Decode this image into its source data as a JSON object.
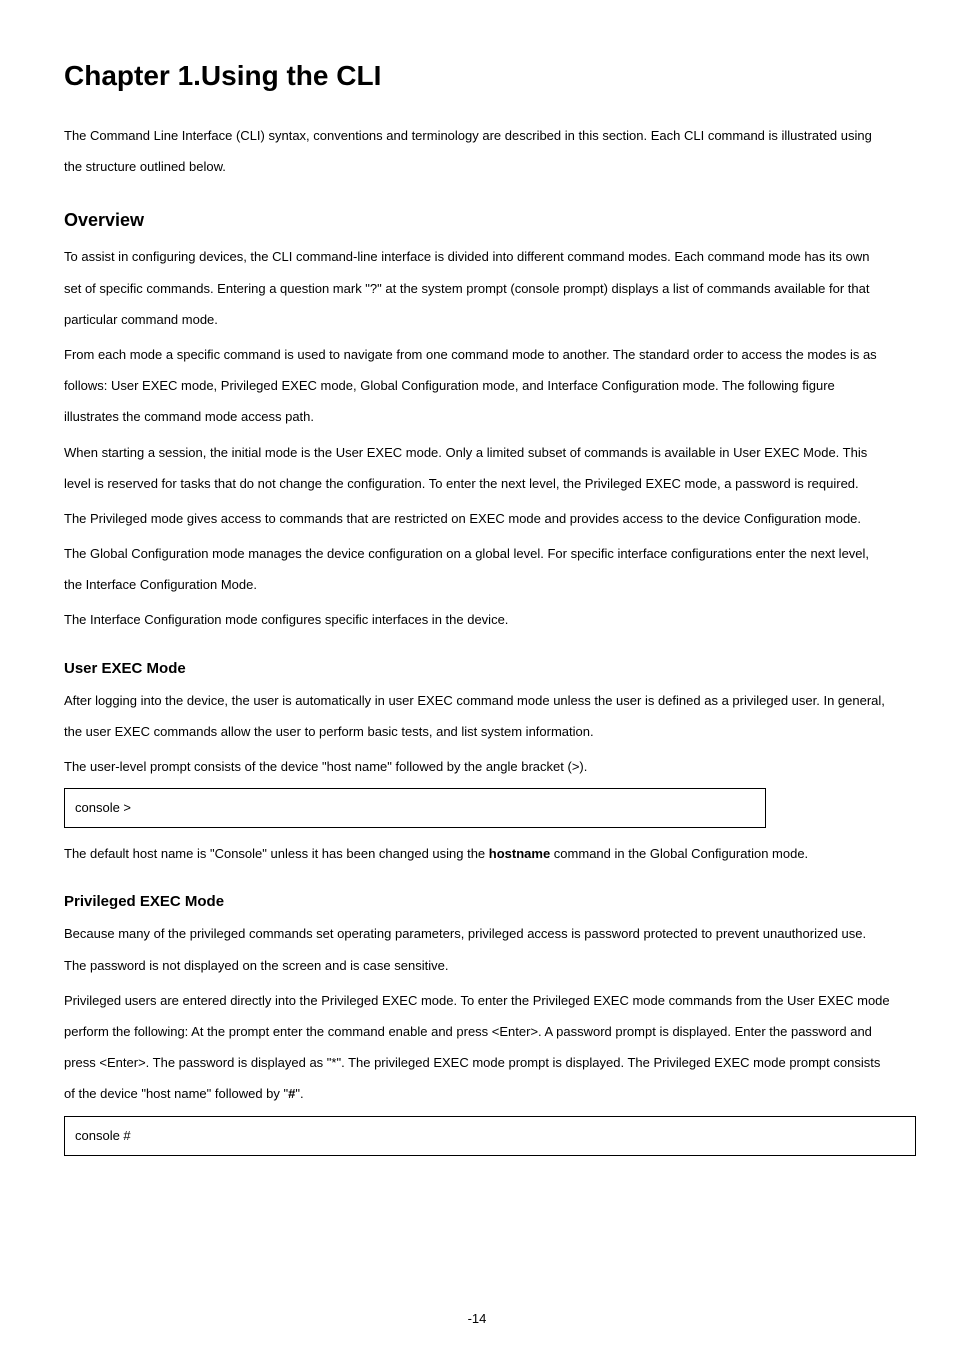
{
  "chapter": {
    "title": "Chapter 1.Using the CLI"
  },
  "intro": {
    "p1": "The Command Line Interface (CLI) syntax, conventions and terminology are described in this section. Each CLI command is illustrated using the structure outlined below."
  },
  "overview": {
    "heading": "Overview",
    "p1": "To assist in configuring devices, the CLI command-line interface is divided into different command modes. Each command mode has its own set of specific commands. Entering a question mark \"?\" at the system prompt (console prompt) displays a list of commands available for that particular command mode.",
    "p2": "From each mode a specific command is used to navigate from one command mode to another. The standard order to access the modes is as follows: User EXEC mode, Privileged EXEC mode, Global Configuration mode, and Interface Configuration mode. The following figure illustrates the command mode access path.",
    "p3": "When starting a session, the initial mode is the User EXEC mode. Only a limited subset of commands is available in User EXEC Mode. This level is reserved for tasks that do not change the configuration. To enter the next level, the Privileged EXEC mode, a password is required.",
    "p4": "The Privileged mode gives access to commands that are restricted on EXEC mode and provides access to the device Configuration mode.",
    "p5": "The Global Configuration mode manages the device configuration on a global level. For specific interface configurations enter the next level, the Interface Configuration Mode.",
    "p6": "The Interface Configuration mode configures specific interfaces in the device."
  },
  "user_exec": {
    "heading": "User EXEC Mode",
    "p1": "After logging into the device, the user is automatically in user EXEC command mode unless the user is defined as a privileged user. In general, the user EXEC commands allow the user to perform basic tests, and list system information.",
    "p2": "The user-level prompt consists of the device \"host name\" followed by the angle bracket (>).",
    "prompt": "console >",
    "after_pre": "The default host name is \"Console\" unless it has been changed using the ",
    "hostname_cmd": "hostname",
    "after_post": " command in the Global Configuration mode."
  },
  "priv_exec": {
    "heading": "Privileged EXEC Mode",
    "p1": "Because many of the privileged commands set operating parameters, privileged access is password protected to prevent unauthorized use. The password is not displayed on the screen and is case sensitive.",
    "p2_pre": "Privileged users are entered directly into the Privileged EXEC mode. To enter the Privileged EXEC mode commands from the User EXEC mode perform the following: At the prompt enter the command enable and press <Enter>. A password prompt is displayed. Enter the password and press <Enter>. The password is displayed as \"*\". The privileged EXEC mode prompt is displayed. The Privileged EXEC mode prompt consists of the device \"host name\" followed by \"",
    "hash": "#",
    "p2_post": "\".",
    "prompt": "console #"
  },
  "footer": {
    "page": "-14"
  }
}
